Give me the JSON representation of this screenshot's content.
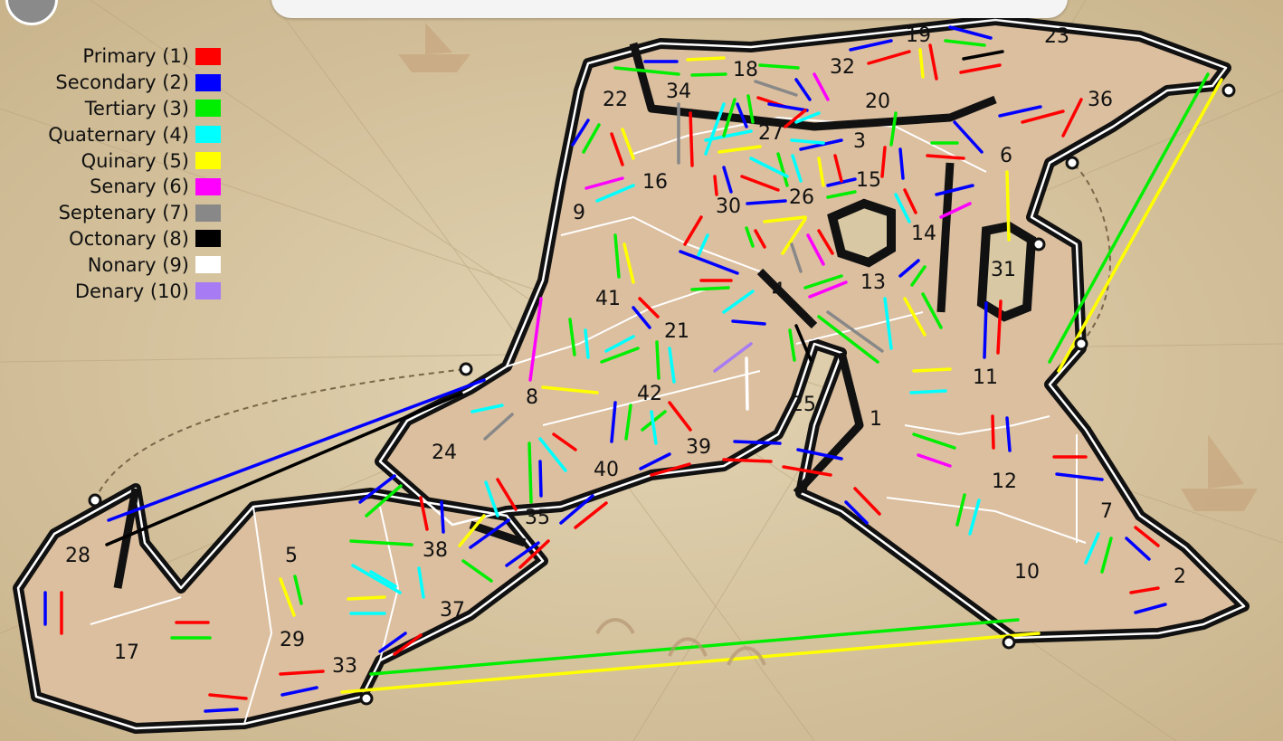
{
  "legend": [
    {
      "label": "Primary (1)",
      "color": "#ff0000"
    },
    {
      "label": "Secondary (2)",
      "color": "#0000ff"
    },
    {
      "label": "Tertiary (3)",
      "color": "#00ee00"
    },
    {
      "label": "Quaternary (4)",
      "color": "#00ffff"
    },
    {
      "label": "Quinary (5)",
      "color": "#ffff00"
    },
    {
      "label": "Senary (6)",
      "color": "#ff00ff"
    },
    {
      "label": "Septenary (7)",
      "color": "#888888"
    },
    {
      "label": "Octonary (8)",
      "color": "#000000"
    },
    {
      "label": "Nonary (9)",
      "color": "#ffffff"
    },
    {
      "label": "Denary (10)",
      "color": "#a77bf3"
    }
  ],
  "territories": [
    "1",
    "2",
    "3",
    "4",
    "5",
    "6",
    "7",
    "8",
    "9",
    "10",
    "11",
    "12",
    "13",
    "14",
    "15",
    "16",
    "17",
    "18",
    "19",
    "20",
    "21",
    "22",
    "23",
    "24",
    "25",
    "26",
    "27",
    "28",
    "29",
    "30",
    "31",
    "32",
    "33",
    "34",
    "35",
    "36",
    "37",
    "38",
    "39",
    "40",
    "41",
    "42"
  ],
  "colors": {
    "parchment": "#d9c8a4",
    "land": "#dcbf9f",
    "border": "#111111",
    "inner_border": "#ffffff"
  },
  "icons": {
    "dice_button": "dice-icon"
  }
}
